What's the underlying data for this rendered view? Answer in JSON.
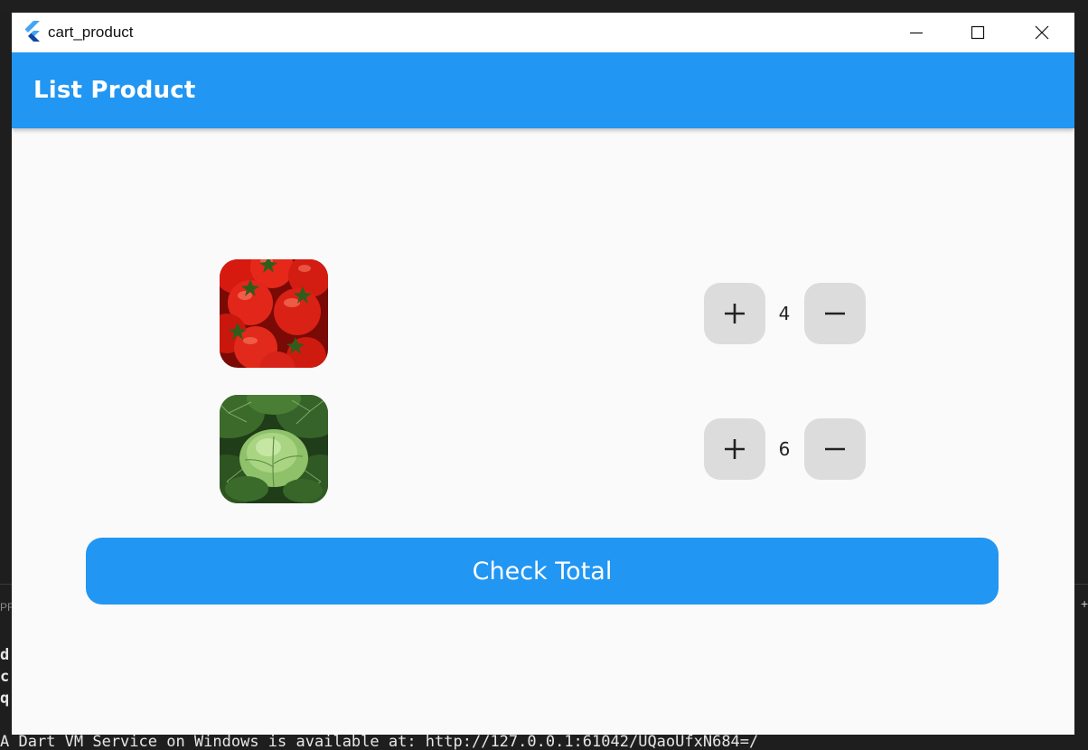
{
  "window": {
    "title": "cart_product"
  },
  "appbar": {
    "title": "List Product"
  },
  "products": [
    {
      "name": "tomato",
      "quantity": "4",
      "increment_icon": "plus-icon",
      "decrement_icon": "minus-icon"
    },
    {
      "name": "cabbage",
      "quantity": "6",
      "increment_icon": "plus-icon",
      "decrement_icon": "minus-icon"
    }
  ],
  "check_button": {
    "label": "Check Total"
  },
  "colors": {
    "primary": "#2196f3",
    "button_grey": "#dcdcdc",
    "background": "#fafafa"
  },
  "terminal": {
    "left_chars": [
      "d",
      "c",
      "q"
    ],
    "tab_left_fragment": "PF",
    "tab_right_fragment": "+",
    "output_line": "A Dart VM Service on Windows is available at: http://127.0.0.1:61042/UQaoUfxN684=/"
  }
}
